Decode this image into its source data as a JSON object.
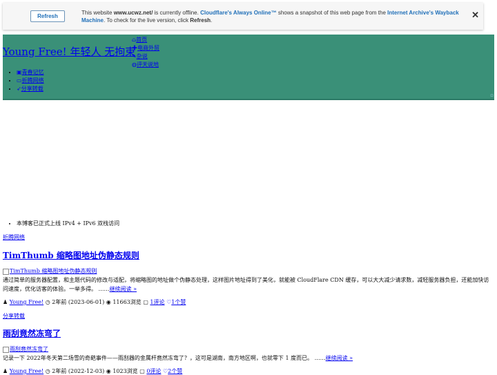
{
  "cloudflare": {
    "refresh_label": "Refresh",
    "msg_1": "This website ",
    "domain": "www.ucwz.net/",
    "msg_2": " is currently offline. ",
    "always_online": "Cloudflare's Always Online™",
    "msg_3": " shows a snapshot of this web page from the ",
    "wayback": "Internet Archive's Wayback Machine",
    "msg_4": ". To check for the live version, click ",
    "refresh_word": "Refresh",
    "msg_5": ".",
    "close_glyph": "✕"
  },
  "header": {
    "site_title": "Young Free! 年轻人 无拘束",
    "main_nav": [
      {
        "icon": "home-icon",
        "glyph": "⌂",
        "label": "首页"
      },
      {
        "icon": "shop-icon",
        "glyph": "✚",
        "label": "电商外贸"
      },
      {
        "icon": "tag-icon",
        "glyph": "✎",
        "label": "杂说"
      },
      {
        "icon": "globe-icon",
        "glyph": "◍",
        "label": "评天说地"
      }
    ],
    "sub_nav": [
      {
        "icon": "camera-icon",
        "glyph": "▣",
        "label": "青春记忆"
      },
      {
        "icon": "laptop-icon",
        "glyph": "▭",
        "label": "折腾网络"
      },
      {
        "icon": "share-icon",
        "glyph": "➶",
        "label": "分享转载"
      }
    ]
  },
  "notice": "本博客已正式上线 IPv4 + IPv6 双栈访问",
  "posts": [
    {
      "category": "折腾网络",
      "title": "TimThumb 缩略图地址伪静态规则",
      "thumb_alt": "TimThumb 缩略图地址伪静态规则",
      "excerpt": "通过简单的服务器配置，和主题代码的修改与适配，将缩略图的地址做个伪静态处理，这样图片地址得到了美化，就能被 CloudFlare CDN 缓存，可以大大减少请求数，减轻服务器负担，还能加快访问速度，优化访客的体验。一举多得。 ……",
      "read_more": "继续阅读 »",
      "author": "Young Free!",
      "time": "2年前 (2023-06-01)",
      "views": "11663浏览",
      "comments": "1评论",
      "likes": "1个赞"
    },
    {
      "category": "分享转载",
      "title": "雨刮竟然冻弯了",
      "thumb_alt": "雨刮竟然冻弯了",
      "excerpt": "记录一下 2022年冬天第二场雪的奇葩事件——雨刮器的金属杆竟然冻弯了？，这可是湖南，南方地区啊，也就零下 1 度而已。 ……",
      "read_more": "继续阅读 »",
      "author": "Young Free!",
      "time": "2年前 (2022-12-03)",
      "views": "1023浏览",
      "comments": "0评论",
      "likes": "2个赞"
    }
  ],
  "colors": {
    "header_bg": "#3a9078",
    "link": "#0000ee"
  }
}
